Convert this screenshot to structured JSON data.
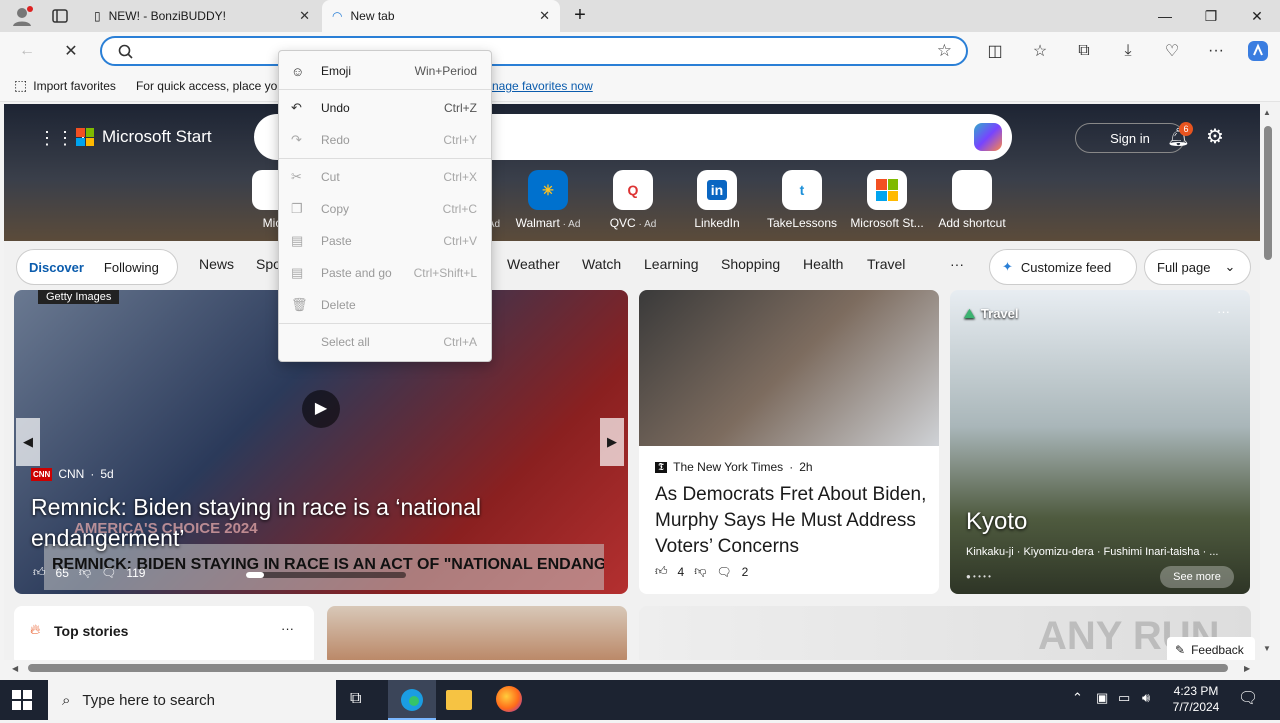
{
  "tabs": [
    {
      "title": "NEW! - BonziBUDDY!",
      "close": "✕"
    },
    {
      "title": "New tab",
      "close": "✕"
    }
  ],
  "new_tab_symbol": "+",
  "window_controls": {
    "minimize": "—",
    "maximize": "❐",
    "close": "✕"
  },
  "favorites_bar": {
    "import_label": "Import favorites",
    "hint_visible": "For quick access, place yo",
    "hint_link": "nage favorites now"
  },
  "page": {
    "brand": "Microsoft Start",
    "sign_in": "Sign in",
    "notif_count": "6",
    "shortcuts": [
      {
        "label": "Mic",
        "ad": ""
      },
      {
        "label": "",
        "ad": "Ad"
      },
      {
        "label": "Walmart",
        "ad": "Ad"
      },
      {
        "label": "QVC",
        "ad": "Ad"
      },
      {
        "label": "LinkedIn",
        "ad": ""
      },
      {
        "label": "TakeLessons",
        "ad": ""
      },
      {
        "label": "Microsoft St...",
        "ad": ""
      },
      {
        "label": "Add shortcut",
        "ad": ""
      }
    ],
    "nav": {
      "discover": "Discover",
      "following": "Following",
      "items": [
        "News",
        "Spo",
        "Weather",
        "Watch",
        "Learning",
        "Shopping",
        "Health",
        "Travel"
      ],
      "more": "···",
      "customize": "Customize feed",
      "full_page": "Full page"
    },
    "big_card": {
      "credit": "Getty Images",
      "source": "CNN",
      "age": "5d",
      "headline": "Remnick: Biden staying in race is a ‘national endangerment’",
      "likes": "65",
      "comments": "119",
      "overlay_text": "REMNICK: BIDEN STAYING IN RACE IS AN ACT OF \"NATIONAL ENDANGERMENT\"",
      "backdrop_text": "AMERICA'S CHOICE 2024"
    },
    "mid_card": {
      "source": "The New York Times",
      "age": "2h",
      "headline": "As Democrats Fret About Biden, Murphy Says He Must Address Voters’ Concerns",
      "likes": "4",
      "comments": "2"
    },
    "travel_card": {
      "category": "Travel",
      "title": "Kyoto",
      "subtitle": "Kinkaku-ji · Kiyomizu-dera · Fushimi Inari-taisha · ...",
      "see_more": "See more"
    },
    "top_stories": "Top stories",
    "feedback": "Feedback",
    "watermark": "ANY RUN"
  },
  "context_menu": [
    {
      "label": "Emoji",
      "shortcut": "Win+Period",
      "icon": "emoji-icon",
      "glyph": "☺",
      "enabled": true
    },
    {
      "label": "Undo",
      "shortcut": "Ctrl+Z",
      "icon": "undo-icon",
      "glyph": "↶",
      "enabled": true
    },
    {
      "label": "Redo",
      "shortcut": "Ctrl+Y",
      "icon": "redo-icon",
      "glyph": "↷",
      "enabled": false
    },
    {
      "label": "Cut",
      "shortcut": "Ctrl+X",
      "icon": "cut-icon",
      "glyph": "✂",
      "enabled": false
    },
    {
      "label": "Copy",
      "shortcut": "Ctrl+C",
      "icon": "copy-icon",
      "glyph": "❐",
      "enabled": false
    },
    {
      "label": "Paste",
      "shortcut": "Ctrl+V",
      "icon": "paste-icon",
      "glyph": "▤",
      "enabled": false
    },
    {
      "label": "Paste and go",
      "shortcut": "Ctrl+Shift+L",
      "icon": "paste-go-icon",
      "glyph": "▤",
      "enabled": false
    },
    {
      "label": "Delete",
      "shortcut": "",
      "icon": "delete-icon",
      "glyph": "🗑",
      "enabled": false
    },
    {
      "label": "Select all",
      "shortcut": "Ctrl+A",
      "icon": "",
      "glyph": "",
      "enabled": false
    }
  ],
  "taskbar": {
    "search_placeholder": "Type here to search",
    "time": "4:23 PM",
    "date": "7/7/2024"
  },
  "colors": {
    "accent": "#2a7fd6",
    "taskbar": "#1c2331"
  }
}
